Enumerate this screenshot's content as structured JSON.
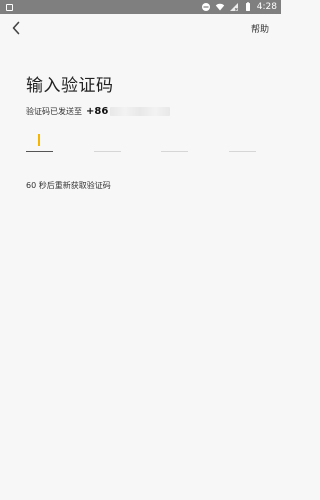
{
  "status_bar": {
    "time": "4:28",
    "icons": [
      "minus-circle-icon",
      "wifi-icon",
      "signal-off-icon",
      "battery-icon"
    ]
  },
  "header": {
    "back_icon": "chevron-left-icon",
    "help_label": "帮助"
  },
  "main": {
    "title": "输入验证码",
    "sent_label": "验证码已发送至",
    "country_code": "+86",
    "otp_length": 4,
    "resend_text": "60 秒后重新获取验证码"
  },
  "colors": {
    "status_bar_bg": "#7f7f7f",
    "caret": "#f7b500",
    "background": "#f7f7f7"
  }
}
